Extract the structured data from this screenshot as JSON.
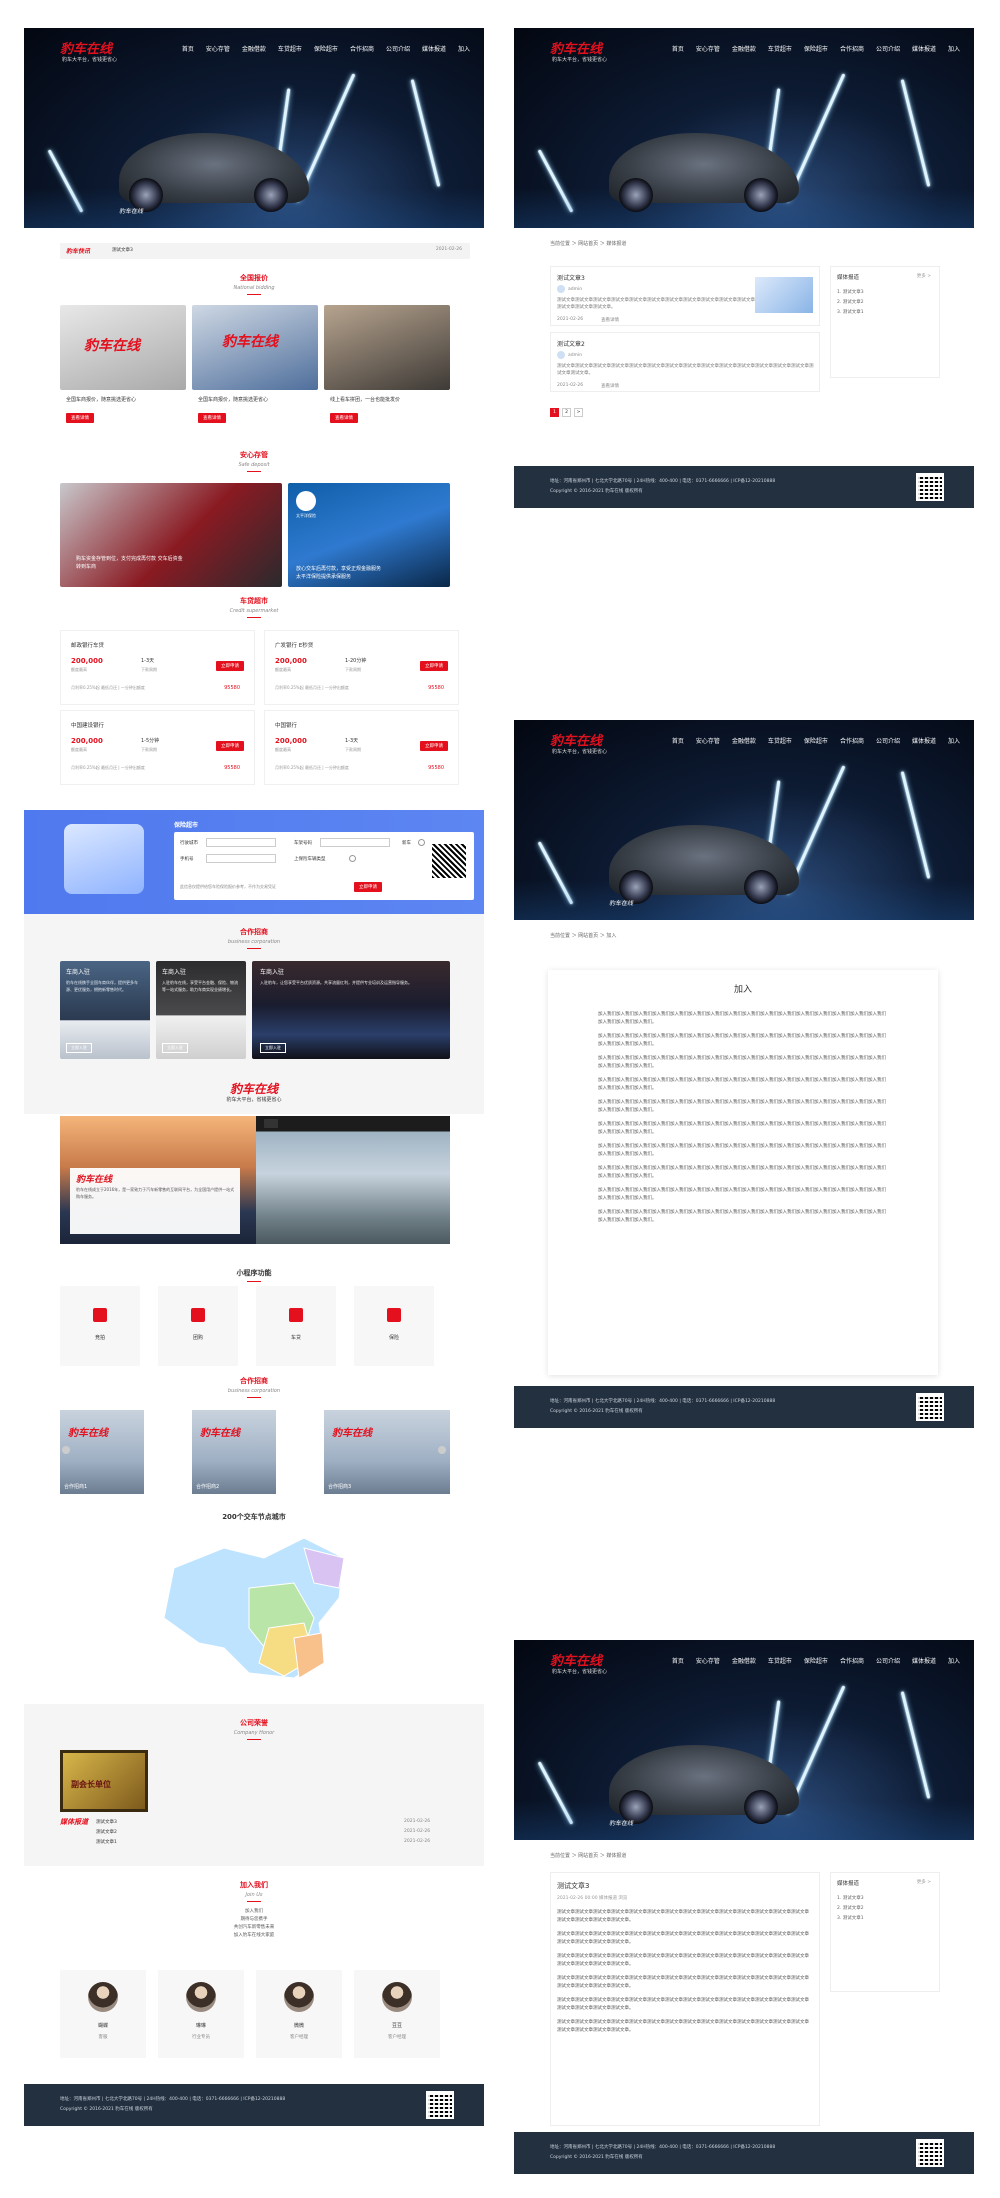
{
  "brand": {
    "logo": "豹车在线",
    "slogan": "豹车大平台，省钱更省心",
    "tagline": "豹车大平台，省钱更省心",
    "accent": "#e4101e"
  },
  "nav": [
    "首页",
    "安心存管",
    "金融借款",
    "车贷超市",
    "保险超市",
    "合作招商",
    "公司介绍",
    "媒体报道",
    "加入"
  ],
  "hero_caption": "豹车在线",
  "news_bar": {
    "logo": "豹车快讯",
    "title": "测试文章3",
    "date": "2021-02-26"
  },
  "sections": {
    "quote": {
      "title": "全国报价",
      "sub": "National bidding"
    },
    "safe": {
      "title": "安心存管",
      "sub": "Safe deposit"
    },
    "market": {
      "title": "车贷超市",
      "sub": "Credit supermarket"
    },
    "coop": {
      "title": "合作招商",
      "sub": "business corporation"
    },
    "mini": {
      "title": "小程序功能"
    },
    "coop2": {
      "title": "合作招商",
      "sub": "business corporation"
    },
    "map": {
      "title": "200个交车节点城市"
    },
    "honor": {
      "title": "公司荣誉",
      "sub": "Company Honor"
    },
    "join": {
      "title": "加入我们",
      "sub": "Join Us"
    }
  },
  "quote_cards": [
    {
      "text": "全国车商报价，随意挑选更省心",
      "btn": "查看详情"
    },
    {
      "text": "全国车商报价，随意挑选更省心",
      "btn": "查看详情"
    },
    {
      "text": "线上看车拼团，一台也能批发价",
      "btn": "查看详情"
    }
  ],
  "safe_cards": [
    {
      "text": "购车资金存管到位，支付完成再付款 交车后资金转到车商"
    },
    {
      "text": "放心交车后再付款，享受正规金融服务 太平洋保险提供承保服务",
      "badge": "太平洋保险"
    }
  ],
  "loans": [
    {
      "bank": "邮政银行车贷",
      "amount": "200,000",
      "amount_label": "额度最高",
      "term": "1-3天",
      "term_label": "下款周期",
      "rate": "月利率0.25%起  最低月还 | 一分钟出额度",
      "phone": "95580",
      "btn": "立即申请"
    },
    {
      "bank": "广发银行 E秒贷",
      "amount": "200,000",
      "amount_label": "额度最高",
      "term": "1-20分钟",
      "term_label": "下款周期",
      "rate": "月利率0.25%起  最低月还 | 一分钟出额度",
      "phone": "95580",
      "btn": "立即申请"
    },
    {
      "bank": "中国建设银行",
      "amount": "200,000",
      "amount_label": "额度最高",
      "term": "1-5分钟",
      "term_label": "下款周期",
      "rate": "月利率0.25%起  最低月还 | 一分钟出额度",
      "phone": "95580",
      "btn": "立即申请"
    },
    {
      "bank": "中国银行",
      "amount": "200,000",
      "amount_label": "额度最高",
      "term": "1-3天",
      "term_label": "下款周期",
      "rate": "月利率0.25%起  最低月还 | 一分钟出额度",
      "phone": "95580",
      "btn": "立即申请"
    }
  ],
  "insurance": {
    "title": "保险超市",
    "fields": [
      "行驶城市",
      "车架号码",
      "手机号",
      "上保险车辆类型"
    ],
    "new_car": "新车",
    "btn": "立即申请",
    "note": "此信息仅提供给您车险保险报价参考，不作为交易凭证"
  },
  "coop_cards": [
    {
      "title": "车商入驻",
      "text": "豹车在线携手全国车商伙伴，提供更多车源、更优服务，拥抱新零售时代。",
      "btn": "立即入驻"
    },
    {
      "title": "车商入驻",
      "text": "入驻豹车在线，享受平台金融、保险、物流等一站式服务，助力车商实现业绩增长。",
      "btn": "立即入驻"
    },
    {
      "title": "车商入驻",
      "text": "入驻豹车，让您享受平台优质资源。共享流量红利，并提供专业培训及运营指导服务。",
      "btn": "立即入驻"
    }
  ],
  "about": {
    "logo": "豹车在线",
    "slogan": "豹车大平台，省钱更省心",
    "intro": "豹车在线成立于2016年，是一家致力于汽车新零售的互联网平台，为全国用户提供一站式购车服务。"
  },
  "mini_items": [
    "竞拍",
    "团购",
    "车贷",
    "保险"
  ],
  "partners": [
    "合作招商1",
    "合作招商2",
    "合作招商3"
  ],
  "honor": {
    "plaque": "副会长单位",
    "items": [
      {
        "title": "测试文章3",
        "date": "2021-02-26"
      },
      {
        "title": "测试文章2",
        "date": "2021-02-26"
      },
      {
        "title": "测试文章1",
        "date": "2021-02-26"
      }
    ],
    "logo": "媒体报道"
  },
  "join_text": [
    "加入我们",
    "期待与您携手",
    "共创汽车新零售未来",
    "加入豹车在线大家庭"
  ],
  "people": [
    {
      "name": "蝴蝶",
      "role": "客服"
    },
    {
      "name": "琳琳",
      "role": "行业专员"
    },
    {
      "name": "微微",
      "role": "客户经理"
    },
    {
      "name": "豆豆",
      "role": "客户经理"
    }
  ],
  "footer": {
    "line1": "地址：河南省郑州市 | 七北大学北路70号 | 24H热线：400-400 | 电话：0371-6666666 | ICP备12-20210888",
    "line2": "Copyright © 2016-2021 豹车在线 版权所有"
  },
  "list_page": {
    "crumb": "当前位置 ＞ 网站首页 ＞ 媒体报道",
    "articles": [
      {
        "title": "测试文章3",
        "author": "admin",
        "body": "测试文章测试文章测试文章测试文章测试文章测试文章测试文章测试文章测试文章测试文章测试文章测试文章测试文章测试文章。",
        "date": "2021-02-26",
        "more": "查看详情"
      },
      {
        "title": "测试文章2",
        "author": "admin",
        "body": "测试文章测试文章测试文章测试文章测试文章测试文章测试文章测试文章测试文章测试文章测试文章测试文章测试文章测试文章测试文章测试文章。",
        "date": "2021-02-26",
        "more": "查看详情"
      }
    ],
    "side_title": "媒体报道",
    "side_more": "更多 >",
    "side_items": [
      "1. 测试文章3",
      "2. 测试文章2",
      "3. 测试文章1"
    ],
    "pages": [
      "1",
      "2",
      ">"
    ]
  },
  "join_page": {
    "crumb": "当前位置 ＞ 网站首页 ＞ 加入",
    "title": "加入",
    "paragraph": "加入我们加入我们加入我们加入我们加入我们加入我们加入我们加入我们加入我们加入我们加入我们加入我们加入我们加入我们加入我们加入我们加入我们加入我们加入我们。"
  },
  "detail_page": {
    "crumb": "当前位置 ＞ 网站首页 ＞ 媒体报道",
    "title": "测试文章3",
    "meta": "2021-02-26 00:00  媒体报道  浏览",
    "paragraph": "测试文章测试文章测试文章测试文章测试文章测试文章测试文章测试文章测试文章测试文章测试文章测试文章测试文章测试文章测试文章测试文章测试文章测试文章。",
    "side_title": "媒体报道",
    "side_more": "更多 >",
    "side_items": [
      "1. 测试文章3",
      "2. 测试文章2",
      "3. 测试文章1"
    ]
  }
}
